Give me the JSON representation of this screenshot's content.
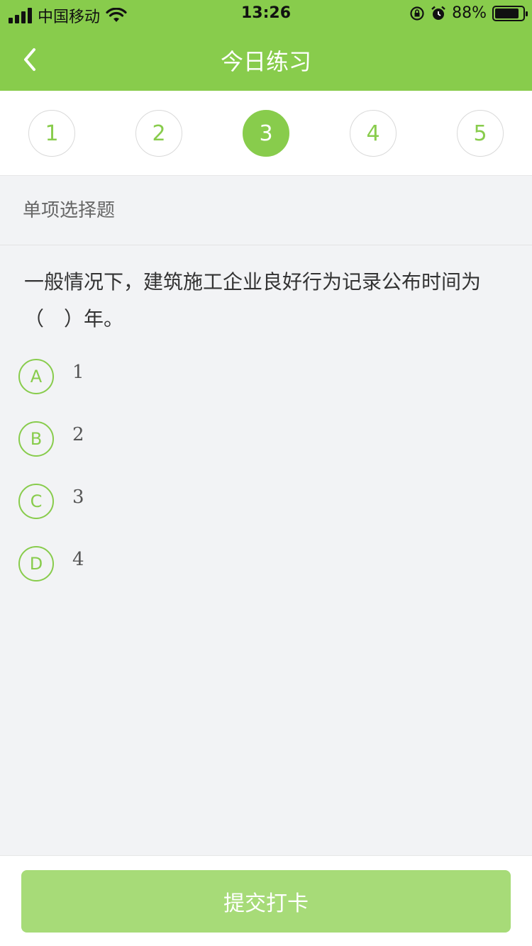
{
  "status_bar": {
    "carrier": "中国移动",
    "time": "13:26",
    "battery": "88%",
    "battery_level": 0.88
  },
  "header": {
    "title": "今日练习",
    "back_icon": "chevron-left-icon"
  },
  "steps": [
    {
      "label": "1",
      "active": false
    },
    {
      "label": "2",
      "active": false
    },
    {
      "label": "3",
      "active": true
    },
    {
      "label": "4",
      "active": false
    },
    {
      "label": "5",
      "active": false
    }
  ],
  "question": {
    "type": "单项选择题",
    "text": "一般情况下，建筑施工企业良好行为记录公布时间为（　）年。",
    "options": [
      {
        "letter": "A",
        "text": "1"
      },
      {
        "letter": "B",
        "text": "2"
      },
      {
        "letter": "C",
        "text": "3"
      },
      {
        "letter": "D",
        "text": "4"
      }
    ]
  },
  "footer": {
    "submit_label": "提交打卡"
  },
  "colors": {
    "accent": "#88cc4c",
    "submit_bg": "#a7db78",
    "page_bg": "#f2f3f5"
  }
}
